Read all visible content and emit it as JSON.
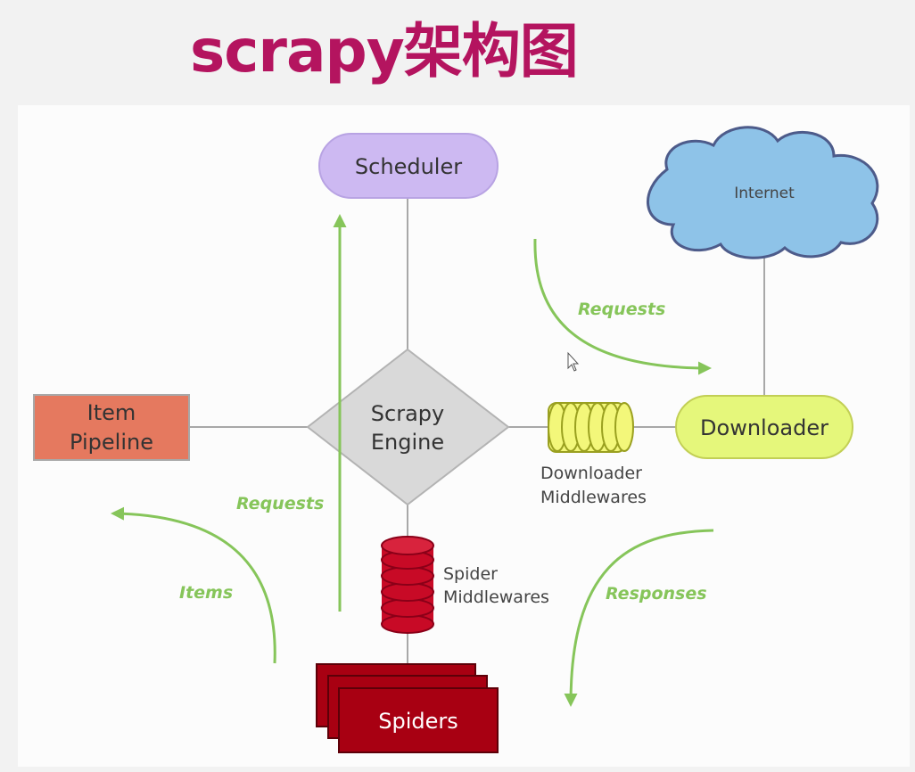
{
  "title": "scrapy架构图",
  "colors": {
    "title": "#b4145f",
    "arrow": "#86c55a",
    "scheduler": "#cdb9f2",
    "internet": "#8ec3e8",
    "downloader": "#e5f77b",
    "engine": "#d9d9d9",
    "item_pipeline": "#e5795f",
    "spiders": "#a80012",
    "middleware_spider": "#c80a26",
    "middleware_downloader": "#f3f77a"
  },
  "nodes": {
    "scheduler": "Scheduler",
    "internet": "Internet",
    "engine_line1": "Scrapy",
    "engine_line2": "Engine",
    "item_pipeline_line1": "Item",
    "item_pipeline_line2": "Pipeline",
    "downloader": "Downloader",
    "downloader_middlewares_line1": "Downloader",
    "downloader_middlewares_line2": "Middlewares",
    "spider_middlewares_line1": "Spider",
    "spider_middlewares_line2": "Middlewares",
    "spiders": "Spiders"
  },
  "arrows": {
    "requests_top": "Requests",
    "requests_left": "Requests",
    "items": "Items",
    "responses": "Responses"
  }
}
